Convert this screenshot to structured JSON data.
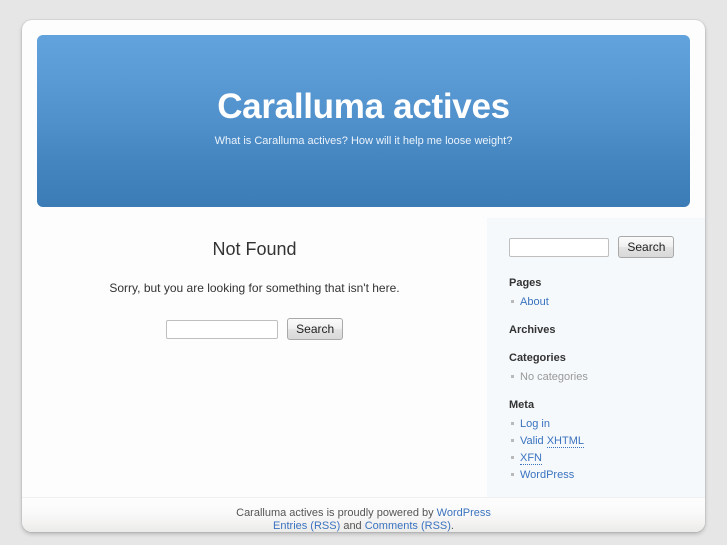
{
  "header": {
    "blog_title": "Caralluma actives",
    "blog_description": "What is Caralluma actives? How will it help me loose weight?"
  },
  "content": {
    "title": "Not Found",
    "message": "Sorry, but you are looking for something that isn't here.",
    "search": {
      "value": "",
      "placeholder": "",
      "button_label": "Search"
    }
  },
  "sidebar": {
    "search": {
      "value": "",
      "placeholder": "",
      "button_label": "Search"
    },
    "widgets": [
      {
        "title": "Pages",
        "items": [
          {
            "label": "About",
            "link": true
          }
        ]
      },
      {
        "title": "Archives",
        "items": []
      },
      {
        "title": "Categories",
        "items": [
          {
            "label": "No categories",
            "link": false
          }
        ]
      },
      {
        "title": "Meta",
        "items": [
          {
            "label": "Log in",
            "link": true
          },
          {
            "label": "Valid XHTML",
            "link": true,
            "abbr": "XHTML"
          },
          {
            "label": "XFN",
            "link": true,
            "abbr": "XFN"
          },
          {
            "label": "WordPress",
            "link": true
          }
        ]
      }
    ]
  },
  "footer": {
    "line1_prefix": "Caralluma actives is proudly powered by ",
    "line1_link": "WordPress",
    "line2_link1": "Entries (RSS)",
    "line2_mid": " and ",
    "line2_link2": "Comments (RSS)",
    "line2_suffix": "."
  },
  "colors": {
    "page_background": "#e6e6e6",
    "container_background": "#fdfdfd",
    "header_gradient_top": "#63a3dd",
    "header_gradient_bottom": "#3b7cb6",
    "sidebar_background": "#f5f9fc",
    "link": "#3b73bf",
    "muted_text": "#999999"
  }
}
